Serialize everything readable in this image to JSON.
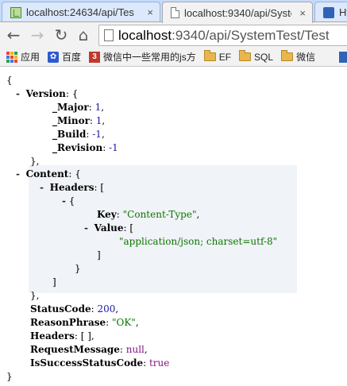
{
  "tabs": [
    {
      "title": "localhost:24634/api/Tes",
      "close": "×"
    },
    {
      "title": "localhost:9340/api/Syste",
      "close": "×"
    },
    {
      "title": "Ht"
    }
  ],
  "toolbar": {
    "back": "←",
    "forward": "→",
    "reload": "↻",
    "home": "⌂",
    "url_host": "localhost",
    "url_rest": ":9340/api/SystemTest/Test"
  },
  "bookmarks": [
    {
      "label": "应用",
      "icon": "apps-icon"
    },
    {
      "label": "百度",
      "icon": "baidu-paw-icon"
    },
    {
      "label": "微信中一些常用的js方",
      "icon": "b3-icon"
    },
    {
      "label": "EF",
      "icon": "folder-icon"
    },
    {
      "label": "SQL",
      "icon": "folder-icon"
    },
    {
      "label": "微信",
      "icon": "folder-icon"
    }
  ],
  "json": {
    "open_brace": "{",
    "close_brace": "}",
    "collapse": "-",
    "version": {
      "key": "Version",
      "major_key": "_Major",
      "major": "1",
      "minor_key": "_Minor",
      "minor": "1",
      "build_key": "_Build",
      "build": "-1",
      "revision_key": "_Revision",
      "revision": "-1"
    },
    "content": {
      "key": "Content",
      "headers_key": "Headers",
      "item_key": "Key",
      "item_key_value": "\"Content-Type\"",
      "value_key": "Value",
      "value_item": "\"application/json; charset=utf-8\""
    },
    "status_code_key": "StatusCode",
    "status_code": "200",
    "reason_key": "ReasonPhrase",
    "reason": "\"OK\"",
    "headers_key": "Headers",
    "headers": "[ ]",
    "request_key": "RequestMessage",
    "request": "null",
    "success_key": "IsSuccessStatusCode",
    "success": "true"
  }
}
